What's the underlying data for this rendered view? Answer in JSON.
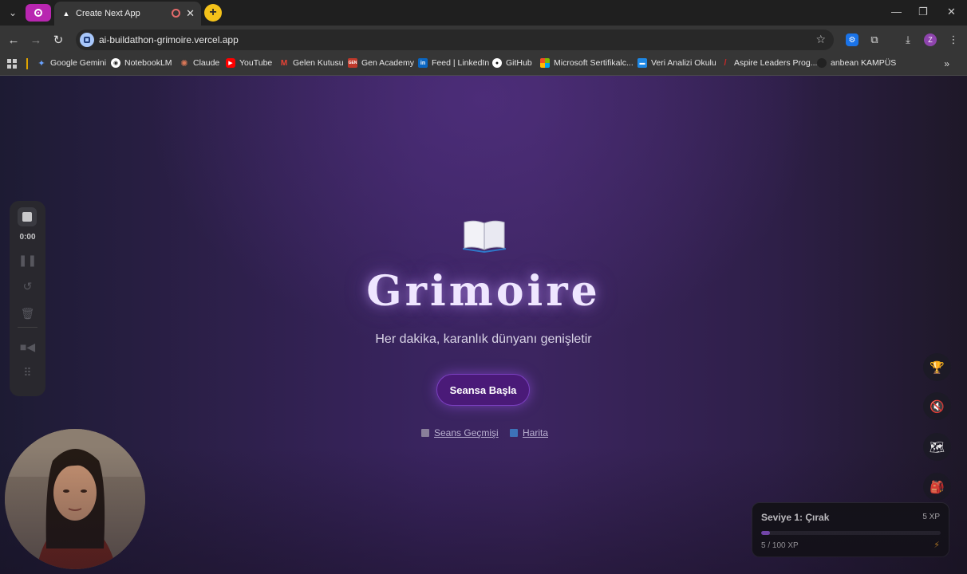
{
  "browser": {
    "tab_title": "Create Next App",
    "new_tab_label": "+",
    "url": "ai-buildathon-grimoire.vercel.app",
    "profile_initial": "Z",
    "bookmarks": [
      {
        "label": "Google Gemini",
        "icon": "gemini-icon",
        "color": "#6aa3ff"
      },
      {
        "label": "NotebookLM",
        "icon": "notebooklm-icon",
        "color": "#ffffff"
      },
      {
        "label": "Claude",
        "icon": "claude-icon",
        "color": "#d97757"
      },
      {
        "label": "YouTube",
        "icon": "youtube-icon",
        "color": "#ff0000"
      },
      {
        "label": "Gelen Kutusu",
        "icon": "gmail-icon",
        "color": "#ea4335"
      },
      {
        "label": "Gen Academy",
        "icon": "gen-academy-icon",
        "color": "#c0392b"
      },
      {
        "label": "Feed | LinkedIn",
        "icon": "linkedin-icon",
        "color": "#0a66c2"
      },
      {
        "label": "GitHub",
        "icon": "github-icon",
        "color": "#ffffff"
      },
      {
        "label": "Microsoft Sertifikalc...",
        "icon": "microsoft-icon",
        "color": "#f25022"
      },
      {
        "label": "Veri Analizi Okulu",
        "icon": "veri-analizi-icon",
        "color": "#1e88e5"
      },
      {
        "label": "Aspire Leaders Prog...",
        "icon": "aspire-icon",
        "color": "#c62828"
      },
      {
        "label": "anbean KAMPÜS",
        "icon": "anbean-icon",
        "color": "#222222"
      }
    ],
    "more_bookmarks_label": "»"
  },
  "main": {
    "title": "Grimoire",
    "subtitle": "Her dakika, karanlık dünyanı genişletir",
    "start_button": "Seansa Başla",
    "links": [
      {
        "label": "Seans Geçmişi",
        "icon": "notebook-icon"
      },
      {
        "label": "Harita",
        "icon": "map-icon"
      }
    ]
  },
  "recorder": {
    "time": "0:00"
  },
  "side_buttons": [
    {
      "name": "trophy-button",
      "icon": "🏆"
    },
    {
      "name": "mute-button",
      "icon": "🔇"
    },
    {
      "name": "map-button",
      "icon": "🗺"
    },
    {
      "name": "backpack-button",
      "icon": "🎒"
    }
  ],
  "xp_panel": {
    "level": "Seviye 1: Çırak",
    "badge": "5 XP",
    "progress_text": "5 / 100 XP",
    "progress_fraction": 0.05,
    "accent": "#9b5de5"
  }
}
